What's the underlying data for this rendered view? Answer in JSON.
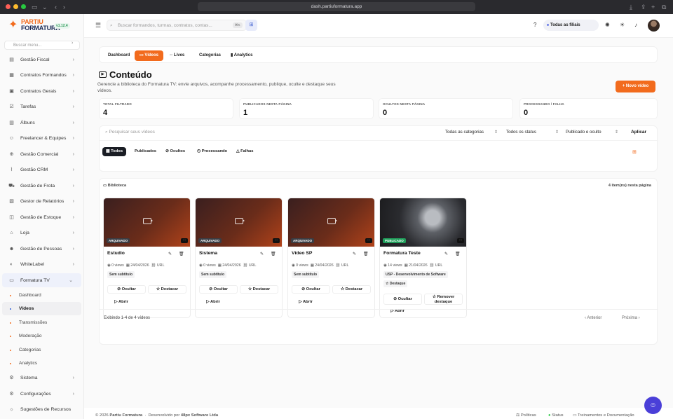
{
  "browser": {
    "url": "dash.partiuformatura.app"
  },
  "brand": {
    "line1": "PARTIU",
    "line2": "FORMATURA",
    "version": "v1.12.4",
    "accent": "#f26b1d",
    "navy": "#1a2a55"
  },
  "sidebar": {
    "search_placeholder": "Buscar menu...",
    "items": [
      {
        "label": "Gestão Fiscal",
        "icon": "file-icon"
      },
      {
        "label": "Contratos Formandos",
        "icon": "contract-icon"
      },
      {
        "label": "Contratos Gerais",
        "icon": "briefcase-icon"
      },
      {
        "label": "Tarefas",
        "icon": "checklist-icon"
      },
      {
        "label": "Álbuns",
        "icon": "album-icon"
      },
      {
        "label": "Freelancer & Equipes",
        "icon": "users-icon"
      },
      {
        "label": "Gestão Comercial",
        "icon": "cart-icon"
      },
      {
        "label": "Gestão CRM",
        "icon": "chart-icon"
      },
      {
        "label": "Gestão de Frota",
        "icon": "truck-icon"
      },
      {
        "label": "Gestor de Relatórios",
        "icon": "report-icon"
      },
      {
        "label": "Gestão de Estoque",
        "icon": "box-icon"
      },
      {
        "label": "Loja",
        "icon": "store-icon"
      },
      {
        "label": "Gestão de Pessoas",
        "icon": "people-icon"
      },
      {
        "label": "WhiteLabel",
        "icon": "palette-icon"
      },
      {
        "label": "Formatura TV",
        "icon": "tv-icon"
      }
    ],
    "sub_items": [
      "Dashboard",
      "Vídeos",
      "Transmissões",
      "Moderação",
      "Categorias",
      "Analytics"
    ],
    "bottom_items": [
      {
        "label": "Sistema",
        "icon": "settings-icon"
      },
      {
        "label": "Configurações",
        "icon": "gear-icon"
      },
      {
        "label": "Sugestões de Recursos",
        "icon": "lightbulb-icon"
      }
    ]
  },
  "topbar": {
    "search_placeholder": "Buscar formandos, turmas, contratos, contas...",
    "shortcut": "⌘K",
    "branch": "Todas as filiais"
  },
  "tabs": [
    "Dashboard",
    "Vídeos",
    "Lives",
    "Categorias",
    "Analytics"
  ],
  "page": {
    "title": "Conteúdo",
    "description": "Gerencie a biblioteca do Formatura TV: envie arquivos, acompanhe processamento, publique, oculte e destaque seus vídeos.",
    "new_button": "+ Novo vídeo"
  },
  "stats": [
    {
      "label": "TOTAL FILTRADO",
      "value": "4"
    },
    {
      "label": "PUBLICADOS NESTA PÁGINA",
      "value": "1"
    },
    {
      "label": "OCULTOS NESTA PÁGINA",
      "value": "0"
    },
    {
      "label": "PROCESSANDO / FALHA",
      "value": "0"
    }
  ],
  "filters": {
    "search_placeholder": "Pesquisar seus vídeos",
    "category": "Todas as categorias",
    "status": "Todos os status",
    "visibility": "Publicado e oculto",
    "apply": "Aplicar",
    "chips": [
      "Todos",
      "Publicados",
      "Ocultos",
      "Processando",
      "Falhas"
    ]
  },
  "library": {
    "label": "Biblioteca",
    "count": "4 item(ns) nesta página",
    "cards": [
      {
        "title": "Estudio",
        "status": "ARQUIVADO",
        "views": "0 views",
        "date": "24/04/2026",
        "link": "URL",
        "subtitle": "Sem subtítulo",
        "hide": "Ocultar",
        "feature": "Destacar",
        "open": "Abrir"
      },
      {
        "title": "Sistema",
        "status": "ARQUIVADO",
        "views": "0 views",
        "date": "24/04/2026",
        "link": "URL",
        "subtitle": "Sem subtítulo",
        "hide": "Ocultar",
        "feature": "Destacar",
        "open": "Abrir"
      },
      {
        "title": "Vídeo SP",
        "status": "ARQUIVADO",
        "views": "0 views",
        "date": "24/04/2026",
        "link": "URL",
        "subtitle": "Sem subtítulo",
        "hide": "Ocultar",
        "feature": "Destacar",
        "open": "Abrir"
      },
      {
        "title": "Formatura Teste",
        "status": "PUBLICADO",
        "views": "14 views",
        "date": "21/04/2026",
        "link": "URL",
        "subtitle": "USP - Desenvolvimento de Software",
        "tag": "Destaque",
        "hide": "Ocultar",
        "feature": "Remover destaque",
        "open": "Abrir"
      }
    ],
    "showing": "Exibindo 1-4 de 4 vídeos",
    "prev": "Anterior",
    "next": "Próxima"
  },
  "footer": {
    "copy": "© 2026",
    "brand": "Partiu Formatura",
    "dev_prefix": "Desenvolvido por",
    "dev": "48px Software Ltda",
    "links": [
      "Políticas",
      "Status",
      "Treinamentos e Documentação"
    ]
  }
}
